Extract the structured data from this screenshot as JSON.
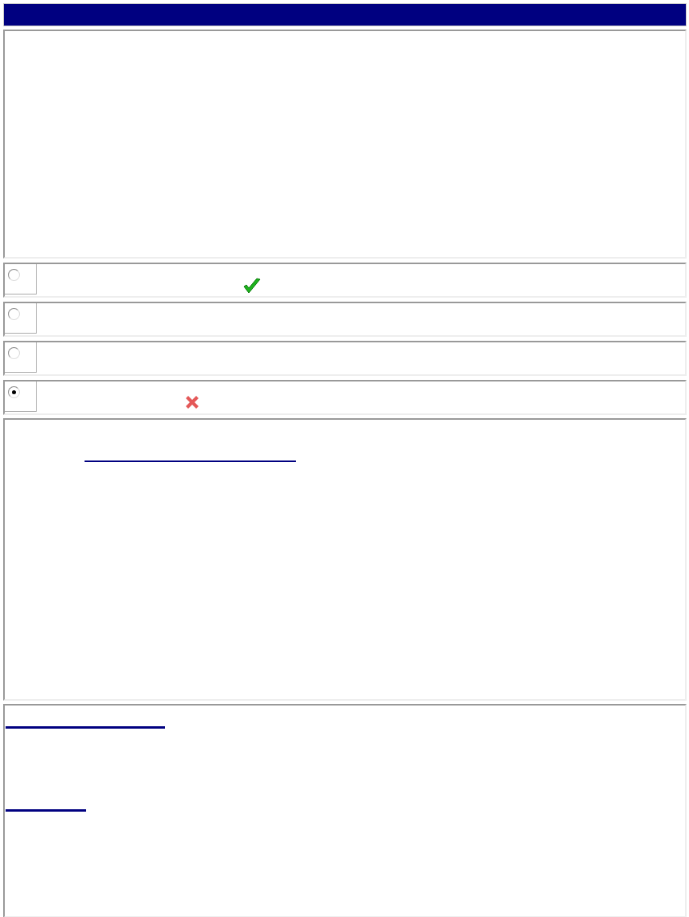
{
  "options": [
    {
      "selected": false,
      "kind": "correct"
    },
    {
      "selected": false,
      "kind": "plain"
    },
    {
      "selected": false,
      "kind": "plain"
    },
    {
      "selected": true,
      "kind": "wrong"
    }
  ]
}
